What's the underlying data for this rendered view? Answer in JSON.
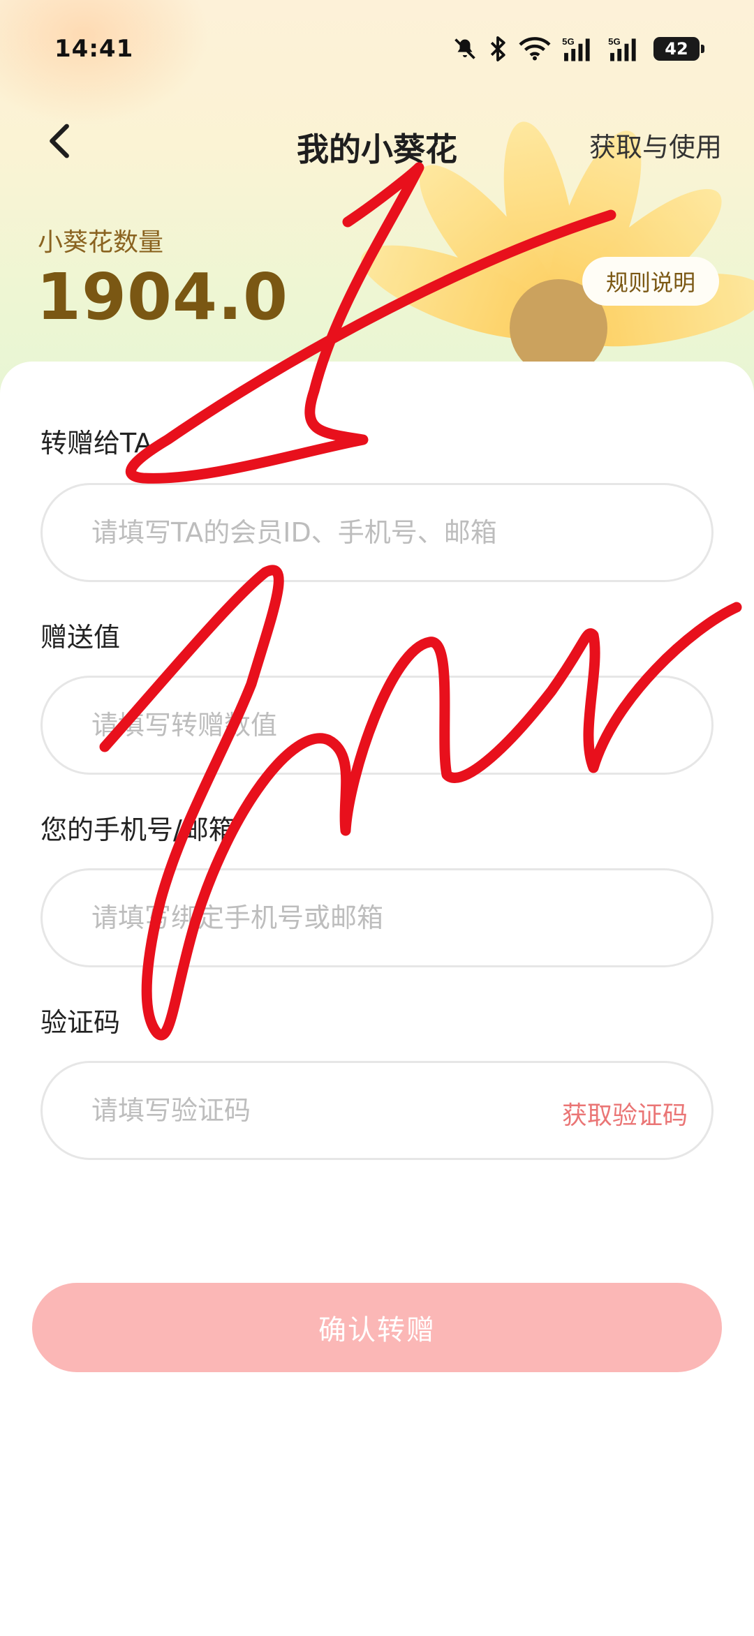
{
  "status_bar": {
    "time": "14:41",
    "battery": "42",
    "network_1": "5G",
    "network_2": "5G"
  },
  "nav": {
    "title": "我的小葵花",
    "right_link": "获取与使用"
  },
  "balance": {
    "label": "小葵花数量",
    "value": "1904.0",
    "rules_button": "规则说明"
  },
  "form": {
    "recipient": {
      "label": "转赠给TA",
      "placeholder": "请填写TA的会员ID、手机号、邮箱",
      "value": ""
    },
    "amount": {
      "label": "赠送值",
      "placeholder": "请填写转赠数值",
      "value": ""
    },
    "contact": {
      "label": "您的手机号/邮箱",
      "placeholder": "请填写绑定手机号或邮箱",
      "value": ""
    },
    "code": {
      "label": "验证码",
      "placeholder": "请填写验证码",
      "value": "",
      "get_code_label": "获取验证码"
    },
    "confirm_label": "确认转赠"
  },
  "colors": {
    "accent_brown": "#7a5713",
    "confirm_pink": "#fbb7b6",
    "link_red": "#ea7575",
    "scribble_red": "#e8101c"
  },
  "icons": {
    "back": "chevron-left-icon",
    "mute": "bell-off-icon",
    "bluetooth": "bluetooth-icon",
    "wifi": "wifi-icon",
    "signal": "cell-signal-icon"
  }
}
